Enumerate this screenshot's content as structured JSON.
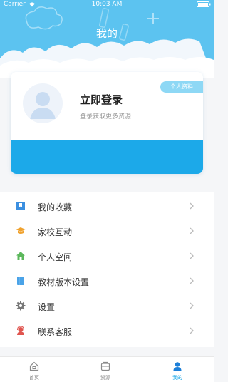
{
  "status_bar": {
    "carrier": "Carrier",
    "time": "10:03 AM"
  },
  "header": {
    "title": "我的"
  },
  "profile": {
    "login_title": "立即登录",
    "login_subtitle": "登录获取更多资源",
    "profile_button": "个人资料"
  },
  "menu": {
    "items": [
      {
        "label": "我的收藏",
        "icon": "bookmark-icon"
      },
      {
        "label": "家校互动",
        "icon": "graduation-cap-icon"
      },
      {
        "label": "个人空间",
        "icon": "home-icon"
      },
      {
        "label": "教材版本设置",
        "icon": "book-icon"
      },
      {
        "label": "设置",
        "icon": "gear-icon"
      },
      {
        "label": "联系客服",
        "icon": "customer-service-icon"
      }
    ]
  },
  "tabs": [
    {
      "label": "首页",
      "icon": "home-tab-icon",
      "active": false
    },
    {
      "label": "资源",
      "icon": "resource-tab-icon",
      "active": false
    },
    {
      "label": "我的",
      "icon": "user-tab-icon",
      "active": true
    }
  ],
  "colors": {
    "header": "#5cc3f0",
    "accent": "#1ca9e9",
    "profile_button": "#8ed8f5"
  }
}
